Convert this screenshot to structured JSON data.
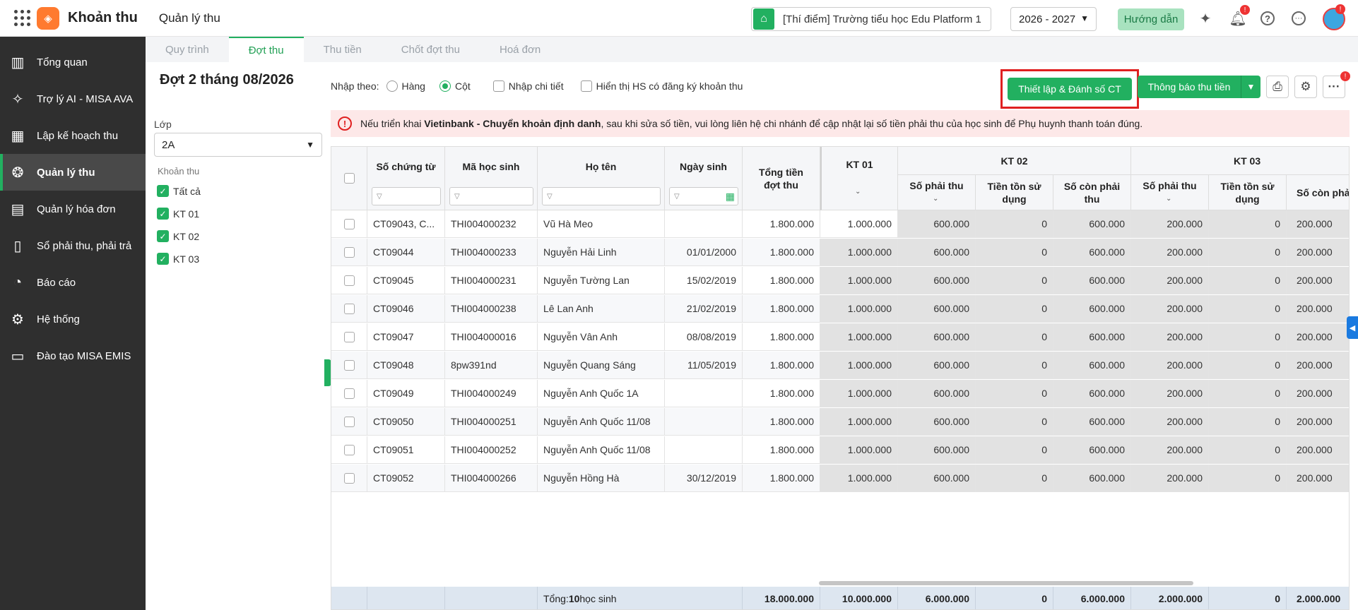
{
  "topbar": {
    "app_name": "Khoản thu",
    "page_name": "Quản lý thu",
    "school": "[Thí điểm] Trường tiểu học Edu Platform 1",
    "year": "2026 - 2027",
    "guide": "Hướng dẫn",
    "bell_badge": "!",
    "avatar_badge": "!"
  },
  "sidebar": {
    "items": [
      {
        "label": "Tổng quan",
        "icon": "bar-chart-icon"
      },
      {
        "label": "Trợ lý AI - MISA AVA",
        "icon": "sparkle-icon"
      },
      {
        "label": "Lập kế hoạch thu",
        "icon": "calendar-icon"
      },
      {
        "label": "Quản lý thu",
        "icon": "hand-coin-icon"
      },
      {
        "label": "Quản lý hóa đơn",
        "icon": "invoice-icon"
      },
      {
        "label": "Sổ phải thu, phải trả",
        "icon": "ledger-icon"
      },
      {
        "label": "Báo cáo",
        "icon": "pie-chart-icon"
      },
      {
        "label": "Hệ thống",
        "icon": "gear-icon"
      },
      {
        "label": "Đào tạo MISA EMIS",
        "icon": "book-icon"
      }
    ]
  },
  "tabs": [
    "Quy trình",
    "Đợt thu",
    "Thu tiền",
    "Chốt đợt thu",
    "Hoá đơn"
  ],
  "left": {
    "title": "Đợt 2 tháng 08/2026",
    "class_label": "Lớp",
    "class_value": "2A",
    "fee_label": "Khoản thu",
    "fees": [
      "Tất cả",
      "KT 01",
      "KT 02",
      "KT 03"
    ]
  },
  "toolbar": {
    "input_by": "Nhập theo:",
    "opt_row": "Hàng",
    "opt_col": "Cột",
    "detail": "Nhập chi tiết",
    "show_registered": "Hiển thị HS có đăng ký khoản thu",
    "setup_btn": "Thiết lập & Đánh số CT",
    "notify_btn": "Thông báo thu tiền",
    "more_badge": "!"
  },
  "alert": {
    "pre": "Nếu triển khai ",
    "bold": "Vietinbank - Chuyển khoản định danh",
    "post": ", sau khi sửa số tiền, vui lòng liên hệ chi nhánh để cập nhật lại số tiền phải thu của học sinh để Phụ huynh thanh toán đúng."
  },
  "table": {
    "headers": {
      "doc_no": "Số chứng từ",
      "student_id": "Mã học sinh",
      "name": "Họ tên",
      "dob": "Ngày sinh",
      "total": "Tổng tiền đợt thu",
      "kt01": "KT 01",
      "kt02": "KT 02",
      "kt03": "KT 03",
      "payable": "Số phải thu",
      "credit_used": "Tiền tồn sử dụng",
      "remaining": "Số còn phải thu"
    },
    "rows": [
      {
        "doc": "CT09043, C...",
        "id": "THI004000232",
        "name": "Vũ Hà Meo",
        "dob": "",
        "total": "1.800.000",
        "kt01": "1.000.000",
        "p2": "600.000",
        "c2": "0",
        "r2": "600.000",
        "p3": "200.000",
        "c3": "0",
        "r3": "200.000"
      },
      {
        "doc": "CT09044",
        "id": "THI004000233",
        "name": "Nguyễn Hải Linh",
        "dob": "01/01/2000",
        "total": "1.800.000",
        "kt01": "1.000.000",
        "p2": "600.000",
        "c2": "0",
        "r2": "600.000",
        "p3": "200.000",
        "c3": "0",
        "r3": "200.000"
      },
      {
        "doc": "CT09045",
        "id": "THI004000231",
        "name": "Nguyễn Tường Lan",
        "dob": "15/02/2019",
        "total": "1.800.000",
        "kt01": "1.000.000",
        "p2": "600.000",
        "c2": "0",
        "r2": "600.000",
        "p3": "200.000",
        "c3": "0",
        "r3": "200.000"
      },
      {
        "doc": "CT09046",
        "id": "THI004000238",
        "name": "Lê Lan Anh",
        "dob": "21/02/2019",
        "total": "1.800.000",
        "kt01": "1.000.000",
        "p2": "600.000",
        "c2": "0",
        "r2": "600.000",
        "p3": "200.000",
        "c3": "0",
        "r3": "200.000"
      },
      {
        "doc": "CT09047",
        "id": "THI004000016",
        "name": "Nguyễn Vân Anh",
        "dob": "08/08/2019",
        "total": "1.800.000",
        "kt01": "1.000.000",
        "p2": "600.000",
        "c2": "0",
        "r2": "600.000",
        "p3": "200.000",
        "c3": "0",
        "r3": "200.000"
      },
      {
        "doc": "CT09048",
        "id": "8pw391nd",
        "name": "Nguyễn Quang Sáng",
        "dob": "11/05/2019",
        "total": "1.800.000",
        "kt01": "1.000.000",
        "p2": "600.000",
        "c2": "0",
        "r2": "600.000",
        "p3": "200.000",
        "c3": "0",
        "r3": "200.000"
      },
      {
        "doc": "CT09049",
        "id": "THI004000249",
        "name": "Nguyễn Anh Quốc 1A",
        "dob": "",
        "total": "1.800.000",
        "kt01": "1.000.000",
        "p2": "600.000",
        "c2": "0",
        "r2": "600.000",
        "p3": "200.000",
        "c3": "0",
        "r3": "200.000"
      },
      {
        "doc": "CT09050",
        "id": "THI004000251",
        "name": "Nguyễn Anh Quốc 11/08",
        "dob": "",
        "total": "1.800.000",
        "kt01": "1.000.000",
        "p2": "600.000",
        "c2": "0",
        "r2": "600.000",
        "p3": "200.000",
        "c3": "0",
        "r3": "200.000"
      },
      {
        "doc": "CT09051",
        "id": "THI004000252",
        "name": "Nguyễn Anh Quốc 11/08",
        "dob": "",
        "total": "1.800.000",
        "kt01": "1.000.000",
        "p2": "600.000",
        "c2": "0",
        "r2": "600.000",
        "p3": "200.000",
        "c3": "0",
        "r3": "200.000"
      },
      {
        "doc": "CT09052",
        "id": "THI004000266",
        "name": "Nguyễn Hồng Hà",
        "dob": "30/12/2019",
        "total": "1.800.000",
        "kt01": "1.000.000",
        "p2": "600.000",
        "c2": "0",
        "r2": "600.000",
        "p3": "200.000",
        "c3": "0",
        "r3": "200.000"
      }
    ],
    "footer": {
      "total_prefix": "Tổng: ",
      "count": "10",
      "total_suffix": " học sinh",
      "total": "18.000.000",
      "kt01": "10.000.000",
      "p2": "6.000.000",
      "c2": "0",
      "r2": "6.000.000",
      "p3": "2.000.000",
      "c3": "0",
      "r3": "2.000.000"
    }
  },
  "colors": {
    "accent": "#22b060",
    "sidebar": "#2f2f2f",
    "alert_bg": "#fde8e8",
    "highlight": "#e02020"
  }
}
